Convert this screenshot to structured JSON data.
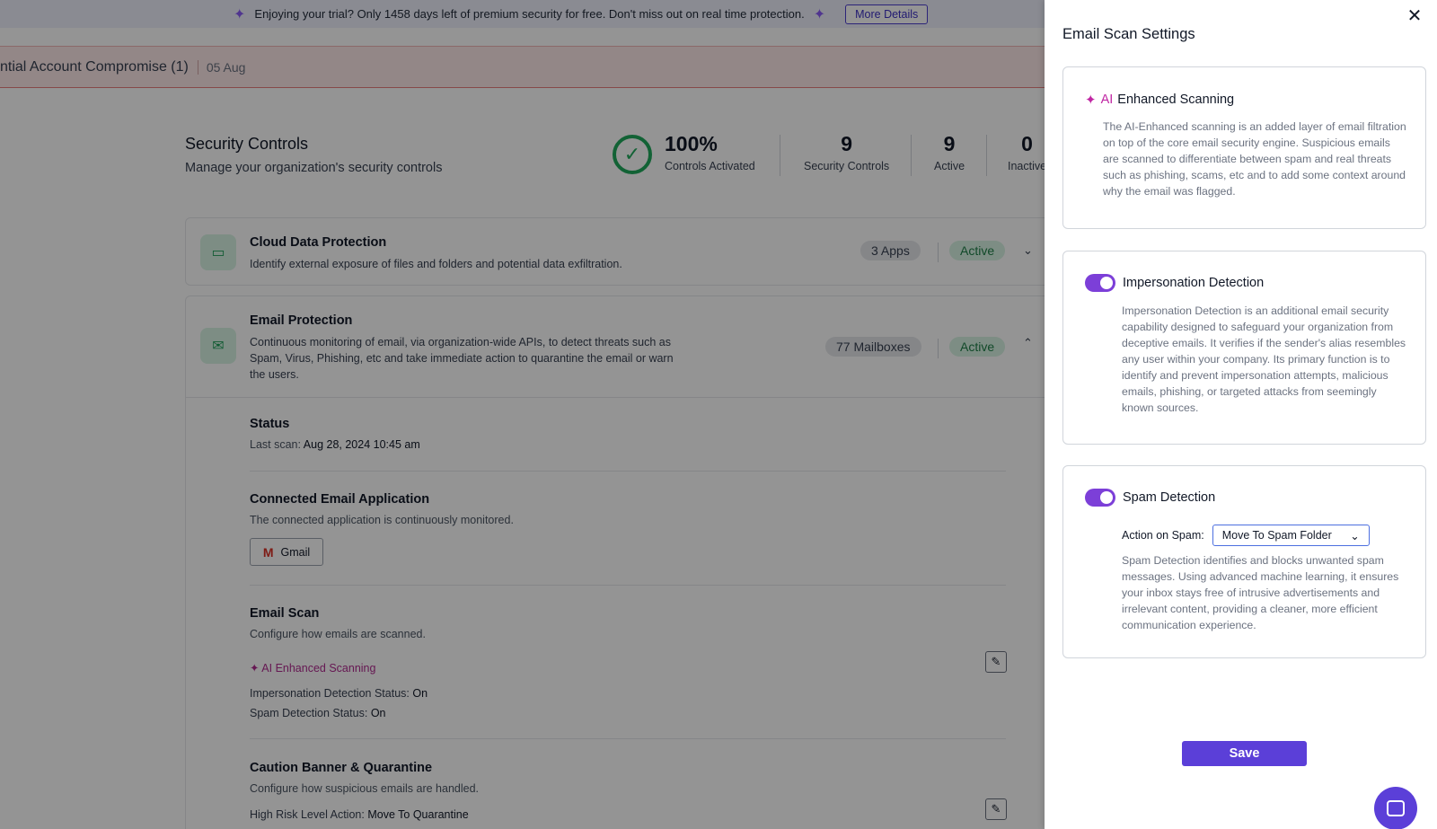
{
  "banner": {
    "text": "Enjoying your trial? Only 1458 days left of premium security for free. Don't miss out on real time protection.",
    "button": "More Details"
  },
  "alert": {
    "title": "ntial Account Compromise (1)",
    "date": "05 Aug"
  },
  "security_controls": {
    "title": "Security Controls",
    "subtitle": "Manage your organization's security controls",
    "stats": [
      {
        "value": "100%",
        "label": "Controls Activated"
      },
      {
        "value": "9",
        "label": "Security Controls"
      },
      {
        "value": "9",
        "label": "Active"
      },
      {
        "value": "0",
        "label": "Inactive"
      }
    ]
  },
  "cloud_card": {
    "title": "Cloud Data Protection",
    "desc": "Identify external exposure of files and folders and potential data exfiltration.",
    "count": "3 Apps",
    "status": "Active"
  },
  "email_card": {
    "title": "Email Protection",
    "desc": "Continuous monitoring of email, via organization-wide APIs, to detect threats such as Spam, Virus, Phishing, etc and take immediate action to quarantine the email or warn the users.",
    "count": "77 Mailboxes",
    "status": "Active"
  },
  "status_section": {
    "title": "Status",
    "last_scan_label": "Last scan:",
    "last_scan_value": "Aug 28, 2024 10:45 am"
  },
  "connected_section": {
    "title": "Connected Email Application",
    "subtitle": "The connected application is continuously monitored.",
    "app": "Gmail"
  },
  "email_scan_section": {
    "title": "Email Scan",
    "subtitle": "Configure how emails are scanned.",
    "ai_label": "AI Enhanced Scanning",
    "impersonation_label": "Impersonation Detection Status:",
    "impersonation_value": "On",
    "spam_label": "Spam Detection Status:",
    "spam_value": "On"
  },
  "caution_section": {
    "title": "Caution Banner & Quarantine",
    "subtitle": "Configure how suspicious emails are handled.",
    "high_label": "High Risk Level Action:",
    "high_value": "Move To Quarantine"
  },
  "drawer": {
    "title": "Email Scan Settings",
    "ai_panel": {
      "ai_word": "AI",
      "title": "Enhanced Scanning",
      "desc": "The AI-Enhanced scanning is an added layer of email filtration on top of the core email security engine. Suspicious emails are scanned to differentiate between spam and real threats such as phishing, scams, etc and to add some context around why the email was flagged."
    },
    "impersonation_panel": {
      "title": "Impersonation Detection",
      "enabled": true,
      "desc": "Impersonation Detection is an additional email security capability designed to safeguard your organization from deceptive emails. It verifies if the sender's alias resembles any user within your company. Its primary function is to identify and prevent impersonation attempts, malicious emails, phishing, or targeted attacks from seemingly known sources."
    },
    "spam_panel": {
      "title": "Spam Detection",
      "enabled": true,
      "action_label": "Action on Spam:",
      "action_value": "Move To Spam Folder",
      "desc": "Spam Detection identifies and blocks unwanted spam messages. Using advanced machine learning, it ensures your inbox stays free of intrusive advertisements and irrelevant content, providing a cleaner, more efficient communication experience."
    },
    "save": "Save"
  },
  "colors": {
    "accent": "#5b3fd8",
    "toggle": "#7c3fd8",
    "ai_pink": "#c026a3",
    "active_green": "#1e9e58"
  }
}
